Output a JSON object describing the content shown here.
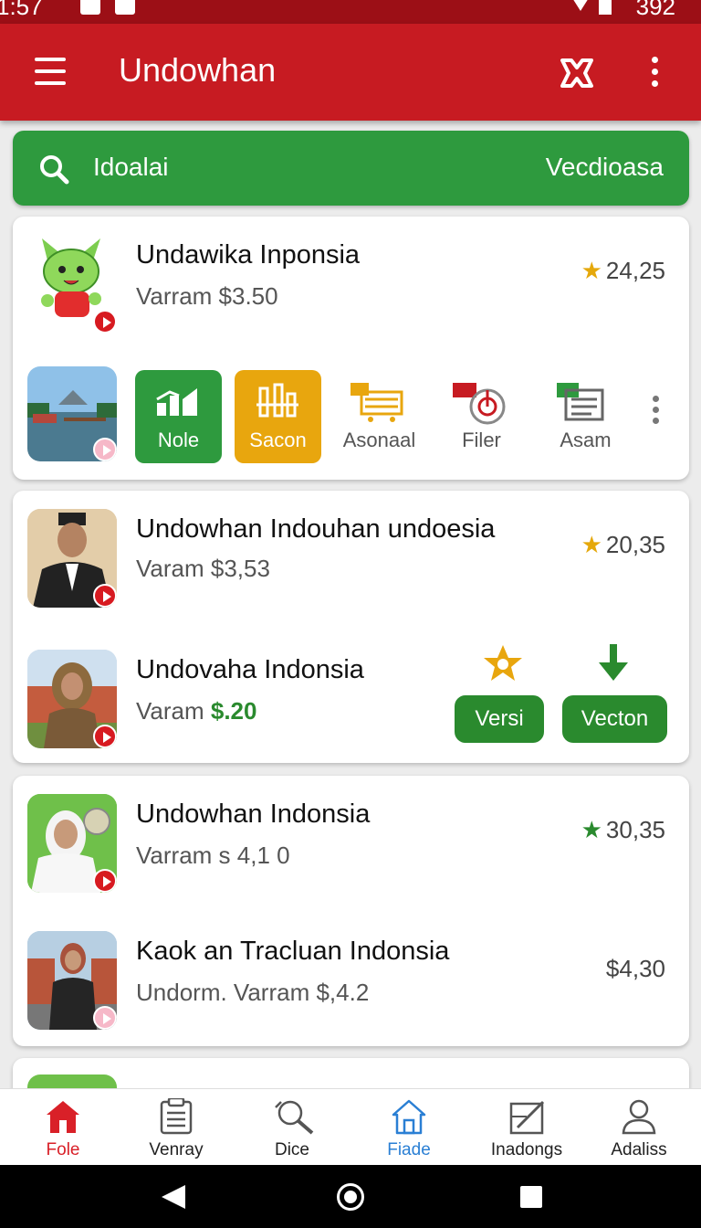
{
  "status_bar": {
    "time": "1:57",
    "battery": "392"
  },
  "app_bar": {
    "title": "Undowhan",
    "menu_icon": "hamburger-icon",
    "action_icon": "crossed-arrows-icon",
    "more_icon": "kebab-icon"
  },
  "search": {
    "placeholder": "Idoalai",
    "right_label": "Vecdioasa"
  },
  "colors": {
    "header": "#c71b22",
    "accent_green": "#2e9a3e",
    "star_gold": "#e5a80b",
    "nav_active": "#d92028",
    "nav_selected_blue": "#2a7fd4"
  },
  "cards": [
    {
      "title": "Undawika Inponsia",
      "subtitle": "Varram $3.50",
      "rating": "24,25",
      "categories": [
        {
          "label": "Nole",
          "icon": "chart-bars-icon"
        },
        {
          "label": "Sacon",
          "icon": "bank-icon"
        },
        {
          "label": "Asonaal",
          "icon": "cart-icon"
        },
        {
          "label": "Filer",
          "icon": "target-icon"
        },
        {
          "label": "Asam",
          "icon": "document-icon"
        }
      ]
    },
    {
      "items": [
        {
          "title": "Undowhan Indouhan undoesia",
          "subtitle": "Varam $3,53",
          "rating": "20,35"
        },
        {
          "title": "Undovaha Indonsia",
          "subtitle_prefix": "Varam ",
          "subtitle_price": "$.20",
          "btn1": "Versi",
          "btn2": "Vecton"
        }
      ]
    },
    {
      "items": [
        {
          "title": "Undowhan Indonsia",
          "subtitle": "Varram s 4,1 0",
          "rating": "30,35"
        },
        {
          "title": "Kaok an Tracluan Indonsia",
          "subtitle": "Undorm. Varram $,4.2",
          "price": "$4,30"
        }
      ]
    }
  ],
  "bottom_nav": [
    {
      "label": "Fole",
      "icon": "home-icon"
    },
    {
      "label": "Venray",
      "icon": "list-icon"
    },
    {
      "label": "Dice",
      "icon": "search-tool-icon"
    },
    {
      "label": "Fiade",
      "icon": "house-outline-icon"
    },
    {
      "label": "Inadongs",
      "icon": "edit-icon"
    },
    {
      "label": "Adaliss",
      "icon": "person-icon"
    }
  ]
}
